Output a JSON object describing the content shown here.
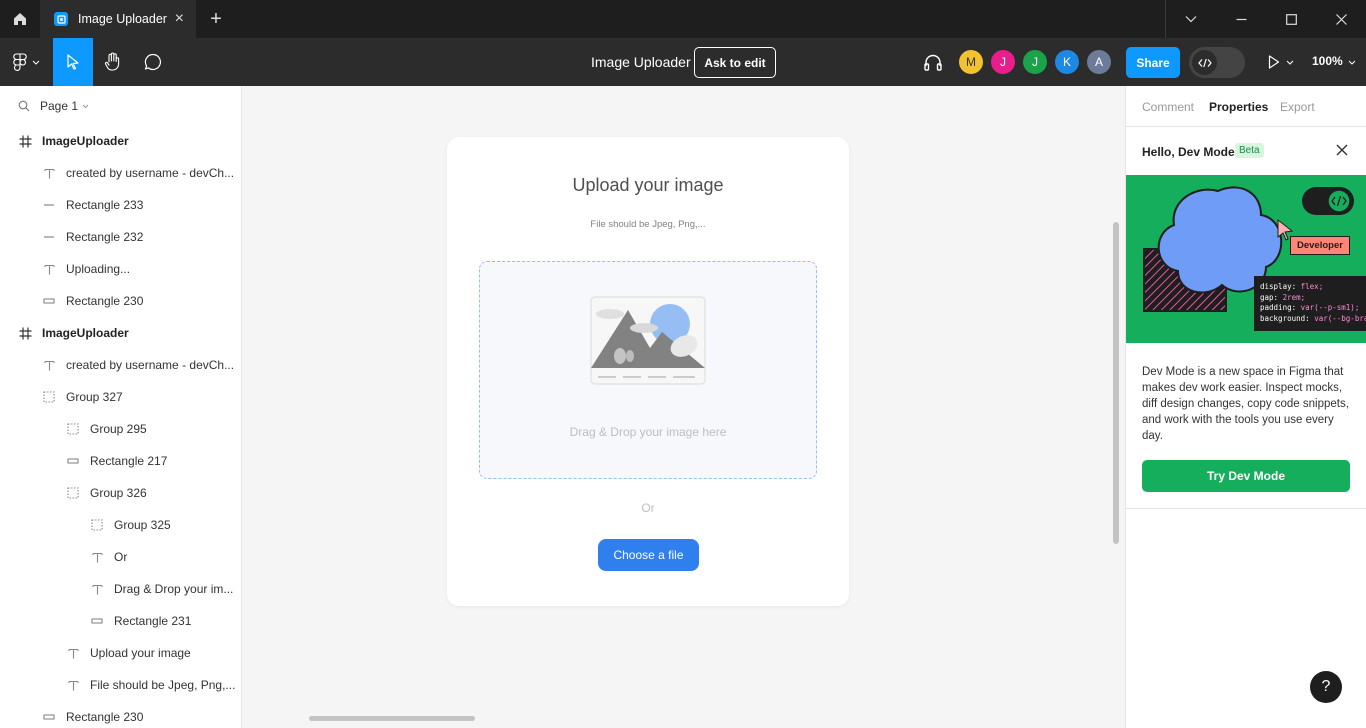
{
  "titlebar": {
    "tab_title": "Image Uploader",
    "new_tab": "+",
    "close": "×"
  },
  "toolbar": {
    "doc_title": "Image Uploader",
    "ask_to_edit": "Ask to edit",
    "share": "Share",
    "zoom": "100%",
    "avatars": [
      {
        "letter": "M",
        "color": "#f2c230",
        "text_color": "#333333"
      },
      {
        "letter": "J",
        "color": "#e91e8c",
        "text_color": "#ffffff"
      },
      {
        "letter": "J",
        "color": "#1aa34a",
        "text_color": "#ffffff"
      },
      {
        "letter": "K",
        "color": "#1e88e5",
        "text_color": "#ffffff"
      },
      {
        "letter": "A",
        "color": "#6b7b99",
        "text_color": "#ffffff"
      }
    ]
  },
  "left_panel": {
    "page": "Page 1",
    "layers": [
      {
        "label": "ImageUploader",
        "icon": "frame-icon",
        "type": "frame"
      },
      {
        "label": "created by username - devCh...",
        "icon": "text-icon",
        "type": "item"
      },
      {
        "label": "Rectangle 233",
        "icon": "line-icon",
        "type": "item"
      },
      {
        "label": "Rectangle 232",
        "icon": "line-icon",
        "type": "item"
      },
      {
        "label": "Uploading...",
        "icon": "text-icon",
        "type": "item"
      },
      {
        "label": "Rectangle 230",
        "icon": "rectangle-icon",
        "type": "item"
      },
      {
        "label": "ImageUploader",
        "icon": "frame-icon",
        "type": "frame"
      },
      {
        "label": "created by username - devCh...",
        "icon": "text-icon",
        "type": "item"
      },
      {
        "label": "Group 327",
        "icon": "group-icon",
        "type": "item"
      },
      {
        "label": "Group 295",
        "icon": "group-icon",
        "type": "item"
      },
      {
        "label": "Rectangle 217",
        "icon": "rectangle-icon",
        "type": "item"
      },
      {
        "label": "Group 326",
        "icon": "group-icon",
        "type": "item"
      },
      {
        "label": "Group 325",
        "icon": "group-icon",
        "type": "item"
      },
      {
        "label": "Or",
        "icon": "text-icon",
        "type": "item"
      },
      {
        "label": "Drag & Drop your im...",
        "icon": "text-icon",
        "type": "item"
      },
      {
        "label": "Rectangle 231",
        "icon": "rectangle-icon",
        "type": "item"
      },
      {
        "label": "Upload your image",
        "icon": "text-icon",
        "type": "item"
      },
      {
        "label": "File should be Jpeg, Png,...",
        "icon": "text-icon",
        "type": "item"
      },
      {
        "label": "Rectangle 230",
        "icon": "rectangle-icon",
        "type": "item"
      }
    ]
  },
  "canvas": {
    "card_title": "Upload your image",
    "card_subtitle": "File should be Jpeg, Png,...",
    "dropzone_text": "Drag & Drop your image here",
    "or": "Or",
    "choose_file": "Choose a file"
  },
  "right_panel": {
    "tabs": [
      "Comment",
      "Properties",
      "Export"
    ],
    "active_tab": "Properties",
    "dev_mode_title": "Hello, Dev Mode",
    "beta": "Beta",
    "illustration": {
      "developer_label": "Developer",
      "code_lines": [
        {
          "prop": "display:",
          "val": "flex;"
        },
        {
          "prop": "gap:",
          "val": "2rem;"
        },
        {
          "prop": "padding:",
          "val": "var(--p-sm1);"
        },
        {
          "prop": "background:",
          "val": "var(--bg-bra"
        }
      ]
    },
    "description": "Dev Mode is a new space in Figma that makes dev work easier. Inspect mocks, diff design changes, copy code snippets, and work with the tools you use every day.",
    "try_button": "Try Dev Mode",
    "help": "?"
  },
  "colors": {
    "accent": "#0d99ff",
    "dev_green": "#14ae5c",
    "upload_blue": "#2f80ed"
  }
}
